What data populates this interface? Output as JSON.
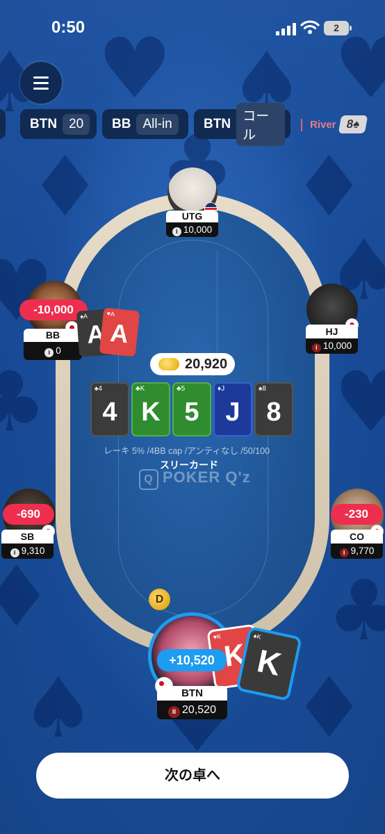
{
  "status_bar": {
    "time": "0:50",
    "battery": "2"
  },
  "history": [
    {
      "position": "BTN",
      "action": "20"
    },
    {
      "position": "BB",
      "action": "All-in"
    },
    {
      "position": "BTN",
      "action": "コール"
    }
  ],
  "street": {
    "label": "River",
    "card": "8♠"
  },
  "pot": "20,920",
  "board": [
    {
      "rank": "4",
      "mini": "♠4",
      "color": "black"
    },
    {
      "rank": "K",
      "mini": "♣K",
      "color": "green"
    },
    {
      "rank": "5",
      "mini": "♣5",
      "color": "green"
    },
    {
      "rank": "J",
      "mini": "♦J",
      "color": "blue"
    },
    {
      "rank": "8",
      "mini": "♠8",
      "color": "black"
    }
  ],
  "rules_text": "レーキ 5% /4BB cap /アンティなし /50/100",
  "hand_name": "スリーカード",
  "logo": "POKER Q'z",
  "logo_mark": "Q",
  "dealer_button": "D",
  "players": {
    "utg": {
      "position": "UTG",
      "stack": "10,000",
      "stack_icon": "i"
    },
    "bb": {
      "position": "BB",
      "stack": "0",
      "stack_icon": "i",
      "result": "-10,000",
      "cards": [
        {
          "rank": "A",
          "mini": "♠A"
        },
        {
          "rank": "A",
          "mini": "♥A"
        }
      ]
    },
    "hj": {
      "position": "HJ",
      "stack": "10,000",
      "stack_icon": "i"
    },
    "sb": {
      "position": "SB",
      "stack": "9,310",
      "stack_icon": "i",
      "result": "-690"
    },
    "co": {
      "position": "CO",
      "stack": "9,770",
      "stack_icon": "i",
      "result": "-230"
    },
    "btn": {
      "position": "BTN",
      "stack": "20,520",
      "stack_icon": "II",
      "result": "+10,520",
      "cards": [
        {
          "rank": "K",
          "mini": "♥K"
        },
        {
          "rank": "K",
          "mini": "♠K"
        }
      ]
    }
  },
  "next_button": "次の卓へ",
  "colors": {
    "loss": "#ee2e4e",
    "win": "#1d9cf0",
    "river": "#e57d88"
  }
}
